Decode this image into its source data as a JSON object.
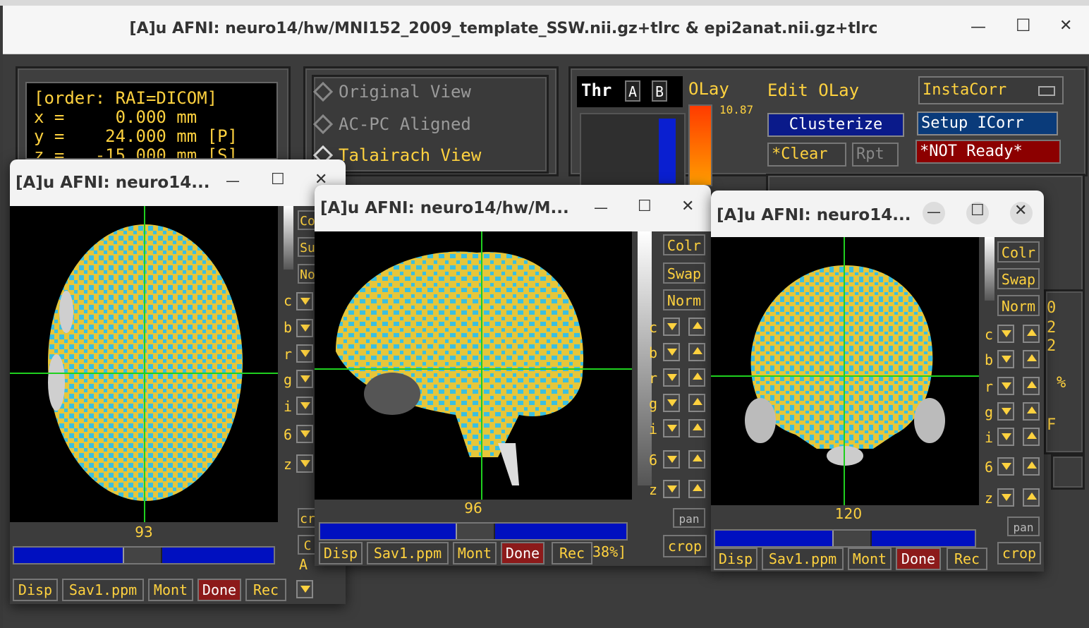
{
  "main": {
    "title": "[A]u AFNI: neuro14/hw/MNI152_2009_template_SSW.nii.gz+tlrc & epi2anat.nii.gz+tlrc",
    "minimize": "—",
    "maximize": "☐",
    "close": "✕",
    "coord_text": "[order: RAI=DICOM]\nx =     0.000 mm\ny =    24.000 mm [P]\nz =   -15.000 mm [S]",
    "views": [
      "Original View",
      "AC-PC Aligned",
      "Talairach View"
    ],
    "thr_label": "Thr",
    "a_label": "A",
    "b_label": "B",
    "olay_label": "OLay",
    "olay_value": "10.87",
    "edit_olay": "Edit OLay",
    "clusterize": "Clusterize",
    "clear": "*Clear",
    "rpt": "Rpt",
    "instacorr": "InstaCorr",
    "setup_icorr": "Setup ICorr",
    "not_ready": "*NOT Ready*"
  },
  "axial": {
    "title": "[A]u AFNI: neuro14...",
    "slice": "93",
    "side": [
      "Co",
      "Su",
      "No",
      "c",
      "b",
      "r",
      "g",
      "i",
      "6",
      "z",
      "cr",
      "C",
      "A"
    ],
    "buttons": [
      "Disp",
      "Sav1.ppm",
      "Mont",
      "Done",
      "Rec"
    ]
  },
  "sagittal": {
    "title": "[A]u AFNI: neuro14/hw/M...",
    "slice": "96",
    "side": [
      "Colr",
      "Swap",
      "Norm",
      "c",
      "b",
      "r",
      "g",
      "i",
      "6",
      "z",
      "pan",
      "crop"
    ],
    "buttons": [
      "Disp",
      "Sav1.ppm",
      "Mont",
      "Done",
      "Rec"
    ],
    "pct": "38%]"
  },
  "coronal": {
    "title": "[A]u AFNI: neuro14...",
    "slice": "120",
    "side": [
      "Colr",
      "Swap",
      "Norm",
      "c",
      "b",
      "r",
      "g",
      "i",
      "6",
      "z",
      "pan",
      "crop"
    ],
    "buttons": [
      "Disp",
      "Sav1.ppm",
      "Mont",
      "Done",
      "Rec"
    ],
    "right_frag": [
      "0",
      "2",
      "2",
      "%",
      "F"
    ]
  },
  "colors": {
    "overlay_yellow": "#e6c63a",
    "overlay_cyan": "#3bbfe0",
    "crosshair": "#1fd01f",
    "text_yellow": "#ffd23f"
  }
}
